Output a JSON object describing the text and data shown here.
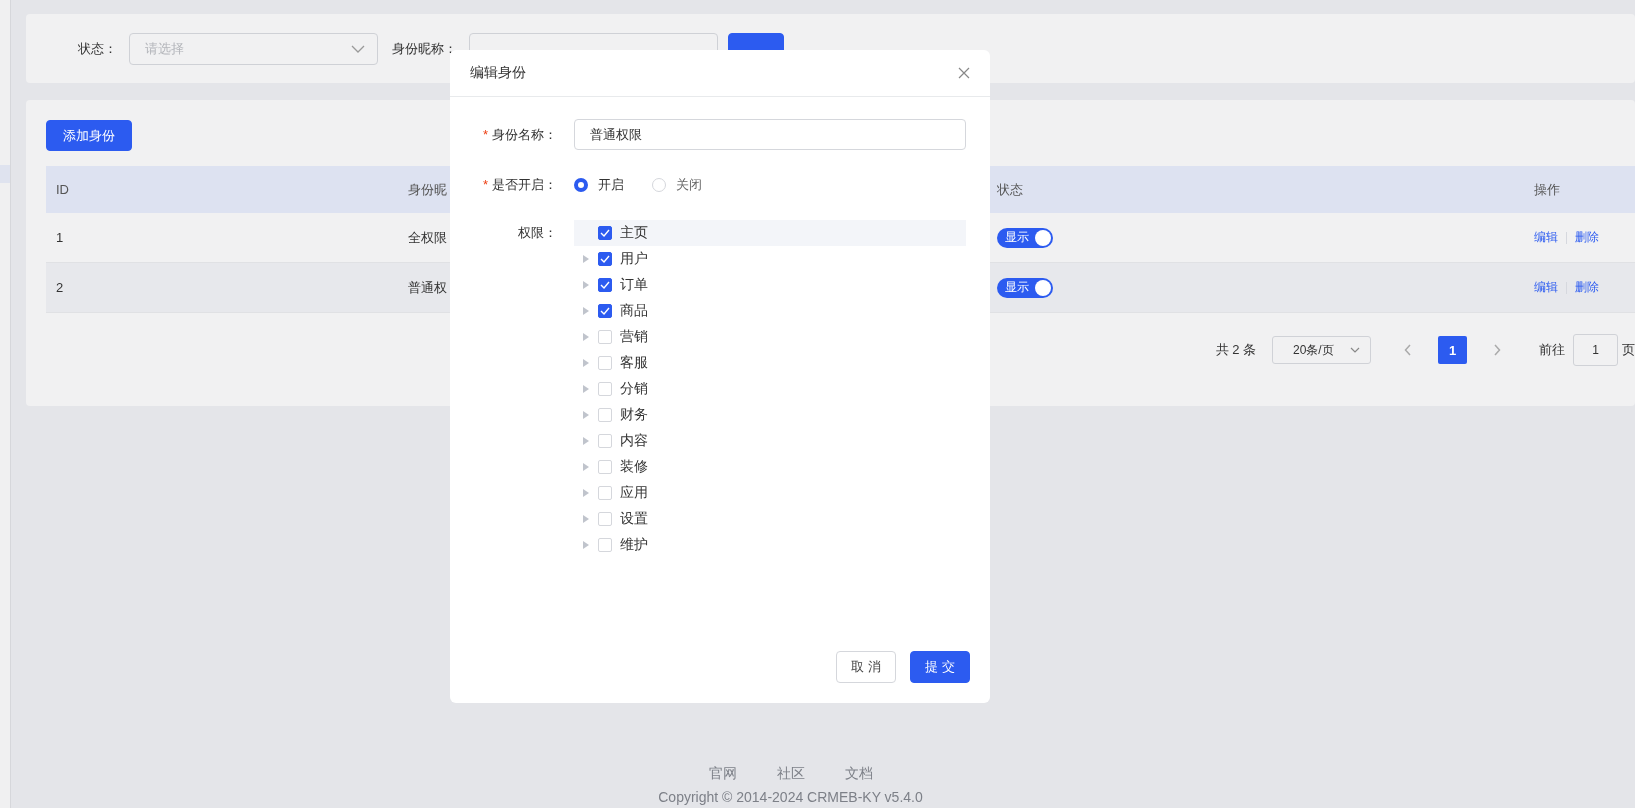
{
  "filter": {
    "fields": [
      {
        "kind": "select",
        "label": "状态：",
        "placeholder": "请选择"
      },
      {
        "kind": "input",
        "label": "身份昵称："
      }
    ]
  },
  "add_button": "添加身份",
  "table": {
    "columns": [
      "ID",
      "身份昵",
      "状态",
      "操作"
    ],
    "rows": [
      {
        "id": "1",
        "name": "全权限",
        "status": {
          "label": "显示",
          "on": true
        },
        "actions": [
          "编辑",
          "删除"
        ]
      },
      {
        "id": "2",
        "name": "普通权",
        "status": {
          "label": "显示",
          "on": true
        },
        "actions": [
          "编辑",
          "删除"
        ]
      }
    ]
  },
  "pagination": {
    "total": "共 2 条",
    "page_size": "20条/页",
    "pages": [
      {
        "label": "1",
        "selected": true
      }
    ],
    "jump_label": "前往",
    "jump_value": "1",
    "jump_suffix": "页"
  },
  "dialog": {
    "title": "编辑身份",
    "name_field": {
      "required_mark": "*",
      "label": "身份名称：",
      "value": "普通权限"
    },
    "enable_field": {
      "required_mark": "*",
      "label": "是否开启：",
      "options": [
        {
          "label": "开启",
          "selected": true
        },
        {
          "label": "关闭",
          "selected": false
        }
      ]
    },
    "permissions": {
      "label": "权限：",
      "items": [
        {
          "label": "主页",
          "checked": true,
          "expandable": false,
          "selected": true
        },
        {
          "label": "用户",
          "checked": true,
          "expandable": true,
          "selected": false
        },
        {
          "label": "订单",
          "checked": true,
          "expandable": true,
          "selected": false
        },
        {
          "label": "商品",
          "checked": true,
          "expandable": true,
          "selected": false
        },
        {
          "label": "营销",
          "checked": false,
          "expandable": true,
          "selected": false
        },
        {
          "label": "客服",
          "checked": false,
          "expandable": true,
          "selected": false
        },
        {
          "label": "分销",
          "checked": false,
          "expandable": true,
          "selected": false
        },
        {
          "label": "财务",
          "checked": false,
          "expandable": true,
          "selected": false
        },
        {
          "label": "内容",
          "checked": false,
          "expandable": true,
          "selected": false
        },
        {
          "label": "装修",
          "checked": false,
          "expandable": true,
          "selected": false
        },
        {
          "label": "应用",
          "checked": false,
          "expandable": true,
          "selected": false
        },
        {
          "label": "设置",
          "checked": false,
          "expandable": true,
          "selected": false
        },
        {
          "label": "维护",
          "checked": false,
          "expandable": true,
          "selected": false
        }
      ]
    },
    "buttons": [
      {
        "kind": "secondary",
        "label": "取 消"
      },
      {
        "kind": "primary",
        "label": "提 交"
      }
    ]
  },
  "footer": {
    "links": [
      "官网",
      "社区",
      "文档"
    ],
    "copyright": "Copyright © 2014-2024 CRMEB-KY v5.4.0"
  }
}
